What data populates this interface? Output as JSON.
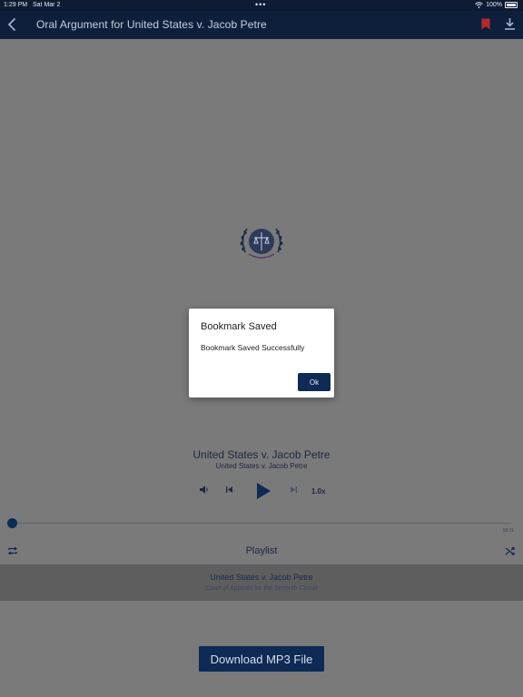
{
  "status_bar": {
    "time": "1:29 PM",
    "date": "Sat Mar 2",
    "battery": "100%",
    "icons": [
      "wifi-icon",
      "battery-icon"
    ]
  },
  "nav": {
    "title": "Oral Argument for United States v. Jacob Petre",
    "icons": [
      "back-chevron-icon",
      "bookmark-icon",
      "download-icon"
    ]
  },
  "player": {
    "track_title": "United States v. Jacob Petre",
    "track_subtitle": "United States v. Jacob Petre",
    "speed": "1.0x",
    "time_remaining": "59:11",
    "progress": 0.0
  },
  "playlist": {
    "label": "Playlist",
    "items": [
      {
        "title": "United States v. Jacob Petre",
        "subtitle": "Court of Appeals for the Seventh Circuit"
      }
    ]
  },
  "download_button": "Download MP3 File",
  "dialog": {
    "title": "Bookmark Saved",
    "message": "Bookmark Saved Successfully",
    "ok_label": "Ok"
  },
  "colors": {
    "nav_bg": "#0e1f3c",
    "accent": "#0e2a55",
    "bookmark_red": "#b52a2a",
    "overlay_bg": "#7a7a7a"
  }
}
